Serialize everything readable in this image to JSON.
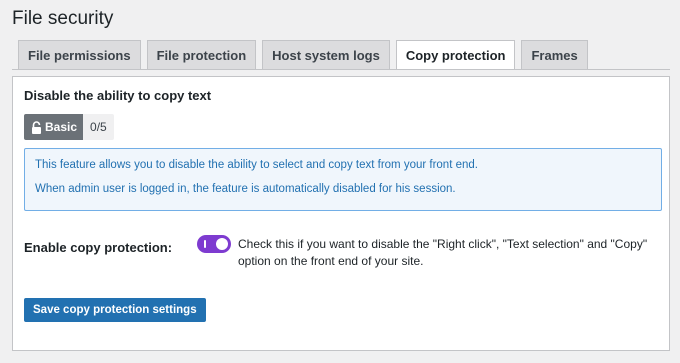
{
  "page": {
    "title": "File security"
  },
  "tabs": [
    {
      "label": "File permissions",
      "active": false
    },
    {
      "label": "File protection",
      "active": false
    },
    {
      "label": "Host system logs",
      "active": false
    },
    {
      "label": "Copy protection",
      "active": true
    },
    {
      "label": "Frames",
      "active": false
    }
  ],
  "section": {
    "title": "Disable the ability to copy text",
    "level_label": "Basic",
    "level_icon": "lock-icon",
    "score": "0/5"
  },
  "info": {
    "line1": "This feature allows you to disable the ability to select and copy text from your front end.",
    "line2": "When admin user is logged in, the feature is automatically disabled for his session."
  },
  "setting": {
    "label": "Enable copy protection:",
    "toggle_on": true,
    "description": "Check this if you want to disable the \"Right click\", \"Text selection\" and \"Copy\" option on the front end of your site."
  },
  "actions": {
    "save_label": "Save copy protection settings"
  },
  "colors": {
    "accent": "#2271b1",
    "toggle": "#7e3bd0",
    "info_bg": "#f0f6fc",
    "info_border": "#72aee6",
    "badge": "#6b7177"
  }
}
